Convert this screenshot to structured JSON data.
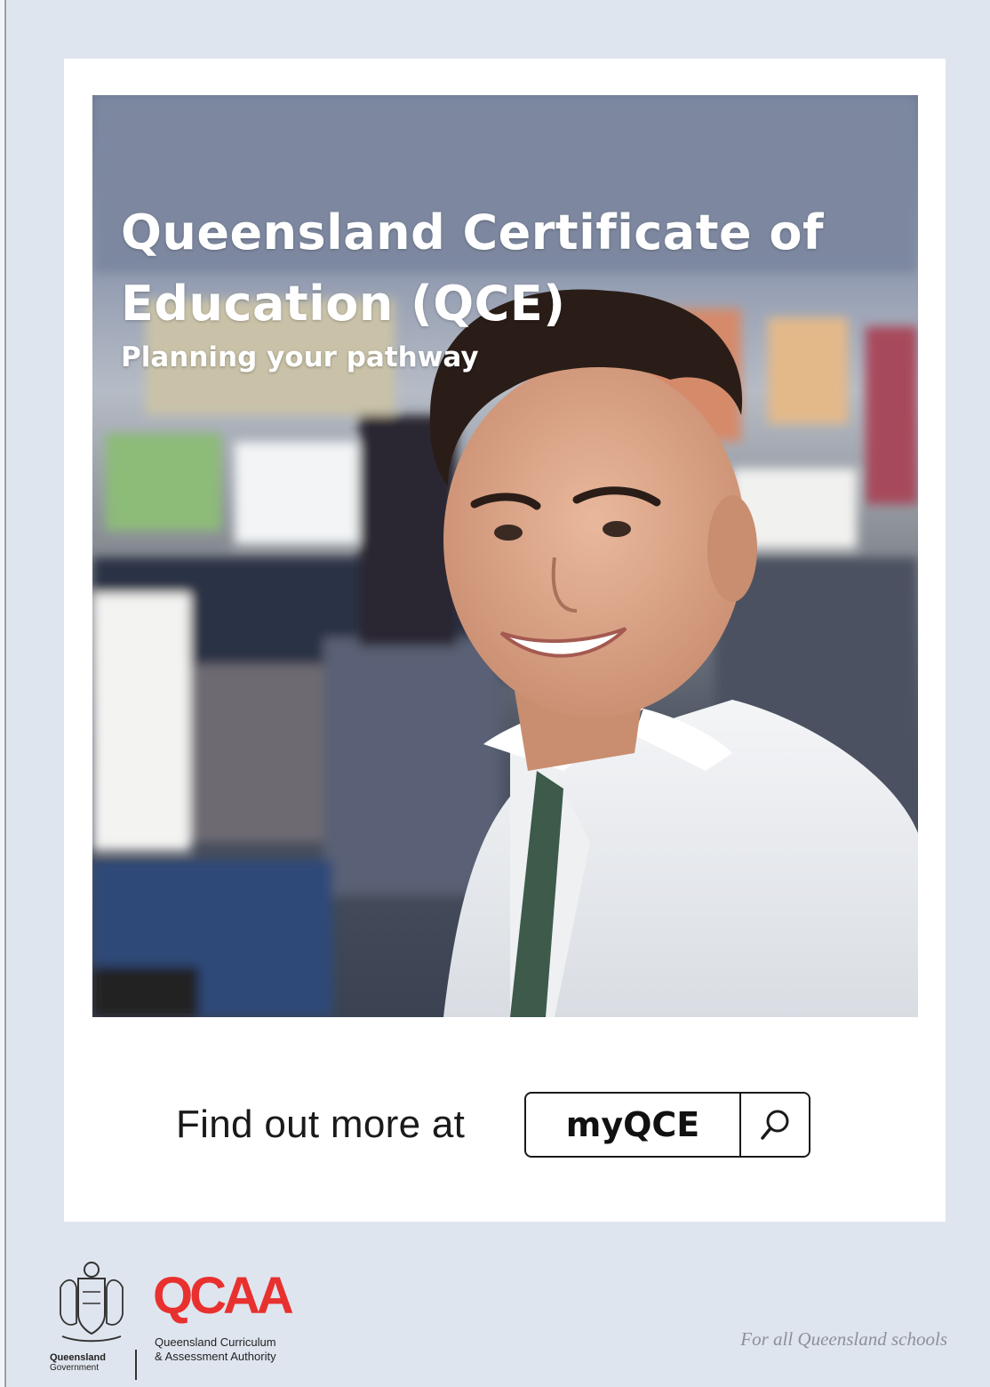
{
  "cover": {
    "title_line1": "Queensland Certificate of",
    "title_line2": "Education (QCE)",
    "subtitle": "Planning your pathway"
  },
  "cta": {
    "text": "Find out more at",
    "search_term": "myQCE",
    "search_icon": "search-icon"
  },
  "footer": {
    "gov_line1": "Queensland",
    "gov_line2": "Government",
    "qcaa_logo": "QCAA",
    "qcaa_name_line1": "Queensland Curriculum",
    "qcaa_name_line2": "& Assessment Authority",
    "tagline": "For all Queensland schools"
  },
  "colors": {
    "page_bg": "#dfe5ee",
    "card_bg": "#ffffff",
    "qcaa_red": "#e8312f",
    "tagline_grey": "#8c9198"
  }
}
